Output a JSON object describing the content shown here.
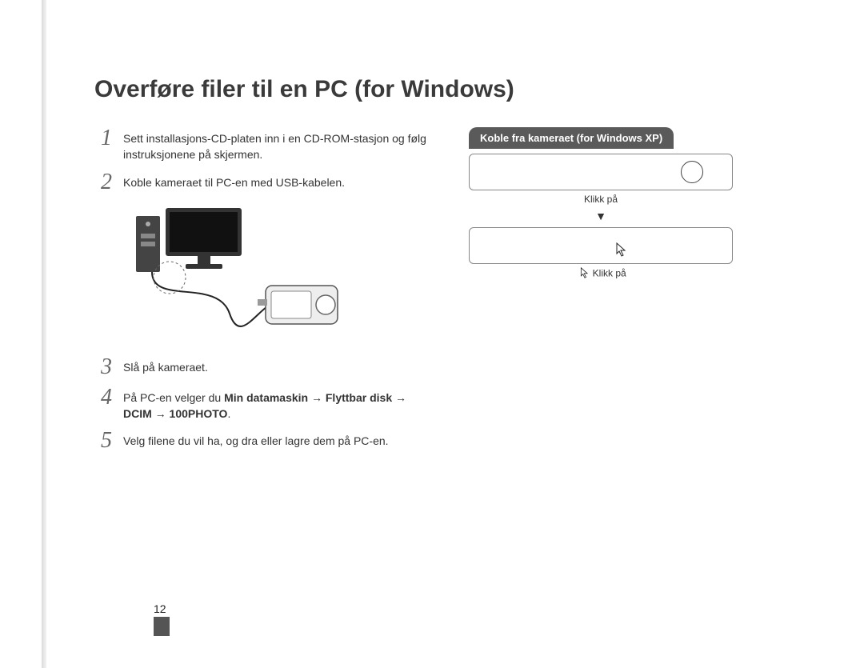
{
  "title": "Overføre filer til en PC (for Windows)",
  "steps": {
    "s1": {
      "num": "1",
      "text": "Sett installasjons-CD-platen inn i en CD-ROM-stasjon og følg instruksjonene på skjermen."
    },
    "s2": {
      "num": "2",
      "text": "Koble kameraet til PC-en med USB-kabelen."
    },
    "s3": {
      "num": "3",
      "text": "Slå på kameraet."
    },
    "s4": {
      "num": "4",
      "prefix": "På PC-en velger du ",
      "bold": "Min datamaskin → Flyttbar disk → DCIM → 100PHOTO",
      "suffix": "."
    },
    "s5": {
      "num": "5",
      "text": "Velg filene du vil ha, og dra eller lagre dem på PC-en."
    }
  },
  "right": {
    "tab": "Koble fra kameraet (for Windows XP)",
    "cap1": "Klikk på",
    "arrow": "▼",
    "cap2": "Klikk på"
  },
  "pagenum": "12"
}
